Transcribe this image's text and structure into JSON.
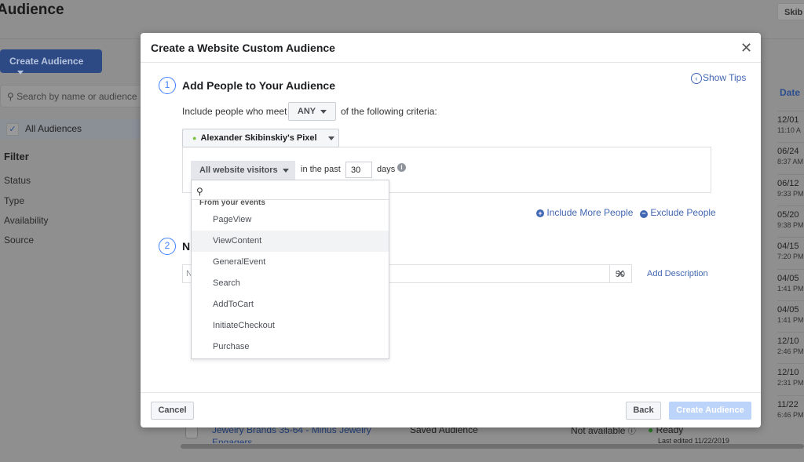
{
  "background": {
    "page_title": "Audience",
    "account_button": "Skib",
    "create_audience": "Create Audience",
    "search_placeholder": "Search by name or audience",
    "all_audiences": "All Audiences",
    "filter_heading": "Filter",
    "filters": [
      "Status",
      "Type",
      "Availability",
      "Source"
    ],
    "date_header": "Date",
    "date_rows": [
      {
        "date": "12/01",
        "time": "11:10 A"
      },
      {
        "date": "06/24",
        "time": "8:37 AM"
      },
      {
        "date": "06/12",
        "time": "9:33 PM"
      },
      {
        "date": "05/20",
        "time": "9:38 PM"
      },
      {
        "date": "04/15",
        "time": "7:20 PM"
      },
      {
        "date": "04/05",
        "time": "1:41 PM"
      },
      {
        "date": "04/05",
        "time": "1:41 PM"
      },
      {
        "date": "12/10",
        "time": "2:46 PM"
      },
      {
        "date": "12/10",
        "time": "2:31 PM"
      },
      {
        "date": "11/22",
        "time": "6:46 PM"
      }
    ],
    "bottom_row": {
      "name": "Jewelry Brands 35-64 - Minus Jewelry",
      "name_line2": "Engagers",
      "type": "Saved Audience",
      "availability": "Not available",
      "status": "Ready",
      "last_edited": "Last edited 11/22/2019"
    }
  },
  "modal": {
    "title": "Create a Website Custom Audience",
    "show_tips": "Show Tips",
    "step1": {
      "number": "1",
      "title": "Add People to Your Audience"
    },
    "include_prefix": "Include people who meet",
    "match_value": "ANY",
    "include_suffix": "of the following criteria:",
    "pixel_name": "Alexander Skibinskiy's Pixel",
    "pixel_status_color": "#7ac142",
    "visitors_select": "All website visitors",
    "in_the_past": "in the past",
    "days_value": "30",
    "days_label": "days",
    "dropdown": {
      "section": "From your events",
      "items": [
        "PageView",
        "ViewContent",
        "GeneralEvent",
        "Search",
        "AddToCart",
        "InitiateCheckout",
        "Purchase"
      ],
      "highlighted": "ViewContent"
    },
    "include_more": "Include More People",
    "exclude": "Exclude People",
    "step2": {
      "number": "2",
      "title_partial": "N"
    },
    "name_placeholder_partial": "N",
    "char_count": "50",
    "add_description": "Add Description",
    "cancel": "Cancel",
    "back": "Back",
    "create": "Create Audience",
    "accent": "#4267b2"
  }
}
